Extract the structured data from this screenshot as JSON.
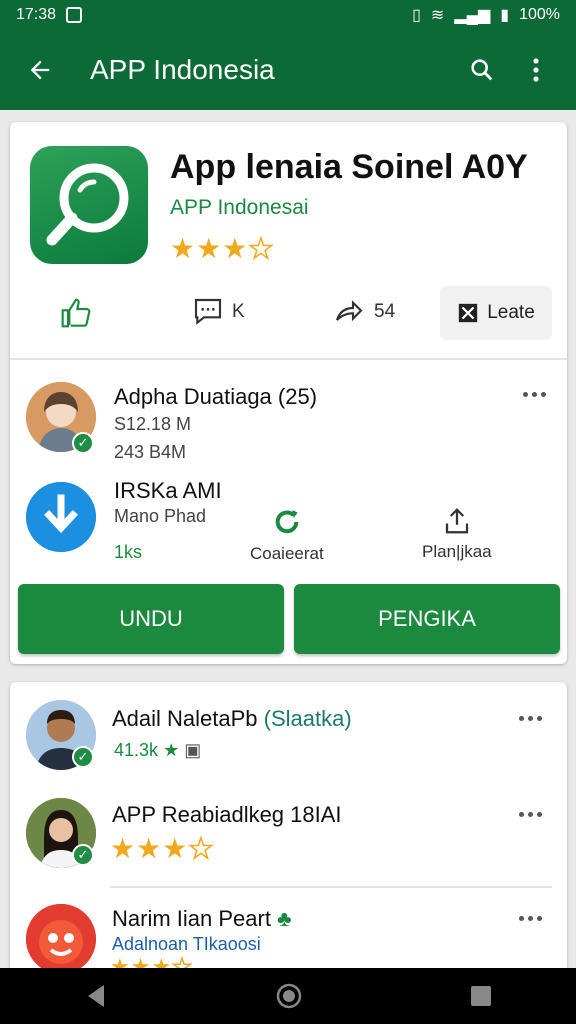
{
  "status": {
    "time": "17:38",
    "battery": "100%"
  },
  "appbar": {
    "title": "APP Indonesia"
  },
  "app": {
    "name": "App lenaia Soinel A0Y",
    "developer": "APP Indonesai",
    "rating": 3
  },
  "actions": {
    "comment_count": "K",
    "share_count": "54",
    "box_label": "Leate"
  },
  "feed": {
    "item1": {
      "title": "Adpha Duatiaga (25)",
      "line1": "S12.18 M",
      "line2": "243 B4M"
    },
    "item2": {
      "title": "IRSKa AMI",
      "line1": "Mano Phad",
      "line2": "1ks"
    },
    "mid_action1": "Coaieerat",
    "mid_action2": "Plan|jkaa"
  },
  "buttons": {
    "primary": "UNDU",
    "secondary": "PENGIKA"
  },
  "reviews": [
    {
      "name": "Adail NaletaPb",
      "tag": "(Slaatka)",
      "meta": "41.3k"
    },
    {
      "name": "APP Reabiadlkeg 18IAI",
      "rating": 3
    },
    {
      "name": "Narim Iian Peart",
      "sub": "Adalnoan TIkaoosi",
      "rating": 3
    }
  ],
  "colors": {
    "primary": "#0c6a36",
    "accent": "#1b8a3f",
    "star": "#f2a81d"
  }
}
